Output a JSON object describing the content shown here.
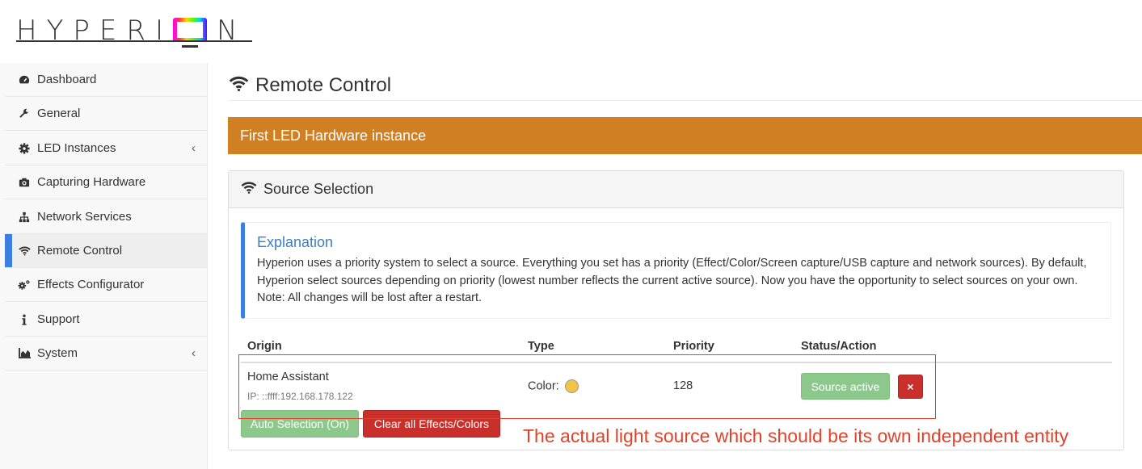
{
  "app": {
    "logo_text_left": "HYPERI",
    "logo_text_right": "N"
  },
  "sidebar": {
    "items": [
      {
        "label": "Dashboard",
        "icon": "dashboard-icon"
      },
      {
        "label": "General",
        "icon": "wrench-icon"
      },
      {
        "label": "LED Instances",
        "icon": "cog-icon",
        "has_submenu": true
      },
      {
        "label": "Capturing Hardware",
        "icon": "camera-icon"
      },
      {
        "label": "Network Services",
        "icon": "sitemap-icon"
      },
      {
        "label": "Remote Control",
        "icon": "wifi-icon",
        "active": true
      },
      {
        "label": "Effects Configurator",
        "icon": "cogs-icon"
      },
      {
        "label": "Support",
        "icon": "info-icon"
      },
      {
        "label": "System",
        "icon": "area-chart-icon",
        "has_submenu": true
      }
    ],
    "arrow_glyph": "‹"
  },
  "main": {
    "title": "Remote Control",
    "instance_name": "First LED Hardware instance",
    "panel": {
      "title": "Source Selection",
      "explanation": {
        "title": "Explanation",
        "text": "Hyperion uses a priority system to select a source. Everything you set has a priority (Effect/Color/Screen capture/USB capture and network sources). By default, Hyperion select sources depending on priority (lowest number reflects the current active source). Now you have the opportunity to select sources on your own. Note: All changes will be lost after a restart."
      },
      "table": {
        "headers": {
          "origin": "Origin",
          "type": "Type",
          "priority": "Priority",
          "status": "Status/Action"
        },
        "rows": [
          {
            "origin": "Home Assistant",
            "origin_ip": "IP: ::ffff:192.168.178.122",
            "type": "Color:",
            "color": "#f3c344",
            "priority": "128",
            "status_button": "Source active",
            "remove_glyph": "×"
          }
        ]
      },
      "buttons": {
        "auto_selection": "Auto Selection (On)",
        "clear_all": "Clear all Effects/Colors"
      }
    }
  },
  "annotation": {
    "text": "The actual light source which should be its own independent entity",
    "color": "#e0432b"
  },
  "colors": {
    "accent": "#3c7fe0",
    "instance_bar": "#d17f23",
    "success": "#8cc88c",
    "danger": "#c9302c"
  }
}
